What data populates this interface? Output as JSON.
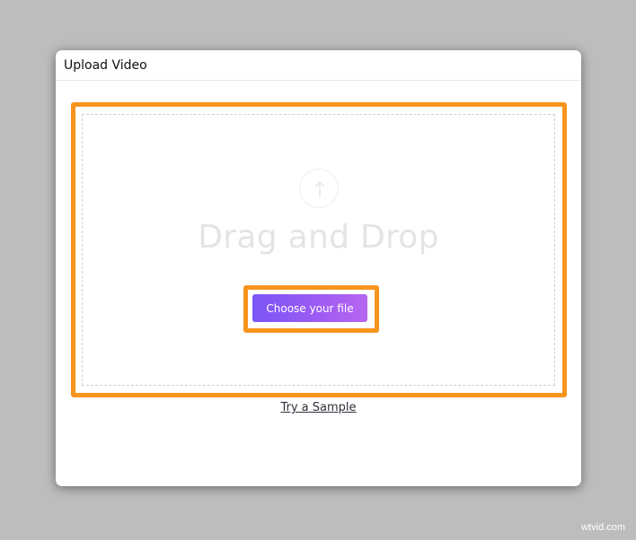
{
  "modal": {
    "title": "Upload Video"
  },
  "dropzone": {
    "icon": "upload-arrow-icon",
    "heading": "Drag and Drop",
    "choose_label": "Choose your file"
  },
  "sample": {
    "link_label": "Try a Sample"
  },
  "watermark": {
    "text": "wtvid.com"
  },
  "colors": {
    "highlight": "#f7941d",
    "button_gradient_start": "#7a55f5",
    "button_gradient_end": "#b767f0",
    "backdrop": "#bdbdbd"
  }
}
